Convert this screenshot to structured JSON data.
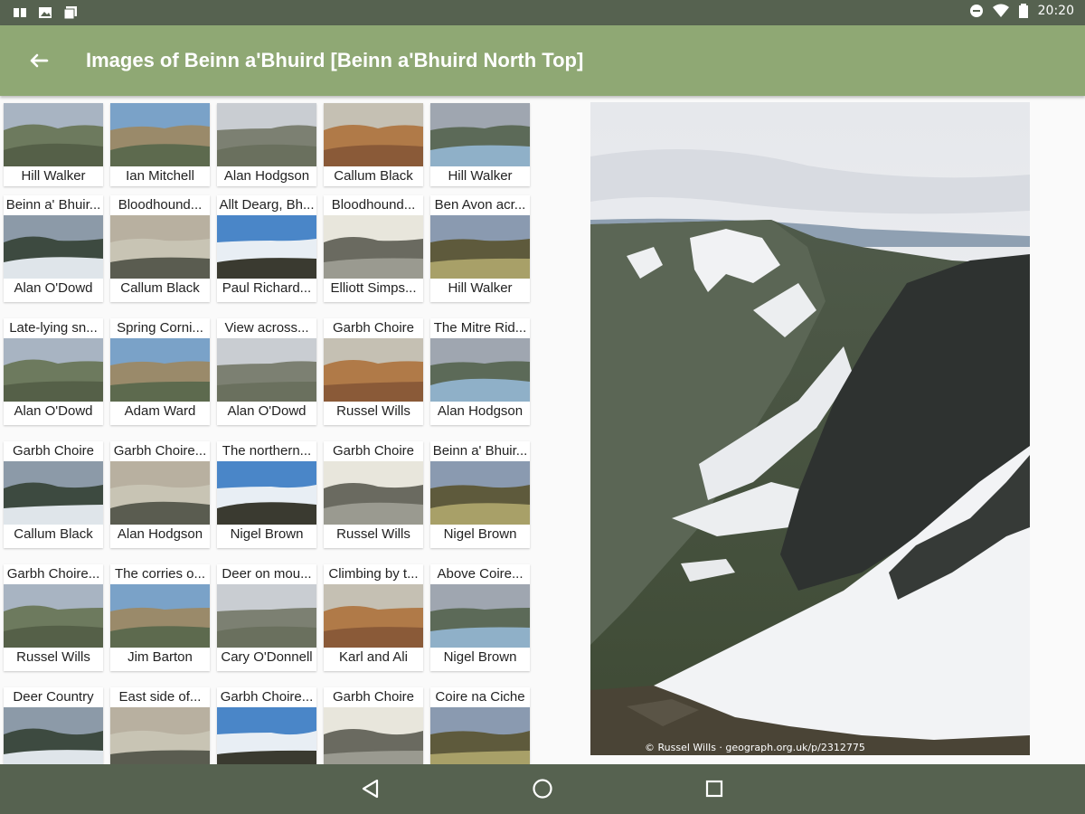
{
  "status_bar": {
    "time": "20:20"
  },
  "app_bar": {
    "title": "Images of Beinn a'Bhuird [Beinn a'Bhuird North Top]"
  },
  "grid": {
    "rows": [
      [
        {
          "title": "",
          "author": "Hill Walker"
        },
        {
          "title": "",
          "author": "Ian Mitchell"
        },
        {
          "title": "",
          "author": "Alan Hodgson"
        },
        {
          "title": "",
          "author": "Callum Black"
        },
        {
          "title": "",
          "author": "Hill Walker"
        }
      ],
      [
        {
          "title": "Beinn a' Bhuir...",
          "author": "Alan O'Dowd"
        },
        {
          "title": "Bloodhound...",
          "author": "Callum Black"
        },
        {
          "title": "Allt Dearg, Bh...",
          "author": "Paul Richard..."
        },
        {
          "title": "Bloodhound...",
          "author": "Elliott Simps..."
        },
        {
          "title": "Ben Avon acr...",
          "author": "Hill Walker"
        }
      ],
      [
        {
          "title": "Late-lying sn...",
          "author": "Alan O'Dowd"
        },
        {
          "title": "Spring Corni...",
          "author": "Adam Ward"
        },
        {
          "title": "View across...",
          "author": "Alan O'Dowd"
        },
        {
          "title": "Garbh Choire",
          "author": "Russel Wills"
        },
        {
          "title": "The Mitre Rid...",
          "author": "Alan Hodgson"
        }
      ],
      [
        {
          "title": "Garbh Choire",
          "author": "Callum Black"
        },
        {
          "title": "Garbh Choire...",
          "author": "Alan Hodgson"
        },
        {
          "title": "The northern...",
          "author": "Nigel Brown"
        },
        {
          "title": "Garbh Choire",
          "author": "Russel Wills"
        },
        {
          "title": "Beinn a' Bhuir...",
          "author": "Nigel Brown"
        }
      ],
      [
        {
          "title": "Garbh Choire...",
          "author": "Russel Wills"
        },
        {
          "title": "The corries o...",
          "author": "Jim Barton"
        },
        {
          "title": "Deer on mou...",
          "author": "Cary O'Donnell"
        },
        {
          "title": "Climbing by t...",
          "author": "Karl and Ali"
        },
        {
          "title": "Above Coire...",
          "author": "Nigel Brown"
        }
      ],
      [
        {
          "title": "Deer Country",
          "author": ""
        },
        {
          "title": "East side of...",
          "author": ""
        },
        {
          "title": "Garbh Choire...",
          "author": ""
        },
        {
          "title": "Garbh Choire",
          "author": ""
        },
        {
          "title": "Coire na Ciche",
          "author": ""
        }
      ]
    ]
  },
  "main_photo": {
    "credit": "© Russel Wills · geograph.org.uk/p/2312775"
  },
  "colors": {
    "status_bar": "#566250",
    "app_bar": "#8fa874",
    "nav_bar": "#566250",
    "background": "#fafafa"
  },
  "icons": {
    "back": "arrow-left-icon",
    "nav_back": "triangle-back-icon",
    "nav_home": "circle-home-icon",
    "nav_recents": "square-recents-icon"
  }
}
